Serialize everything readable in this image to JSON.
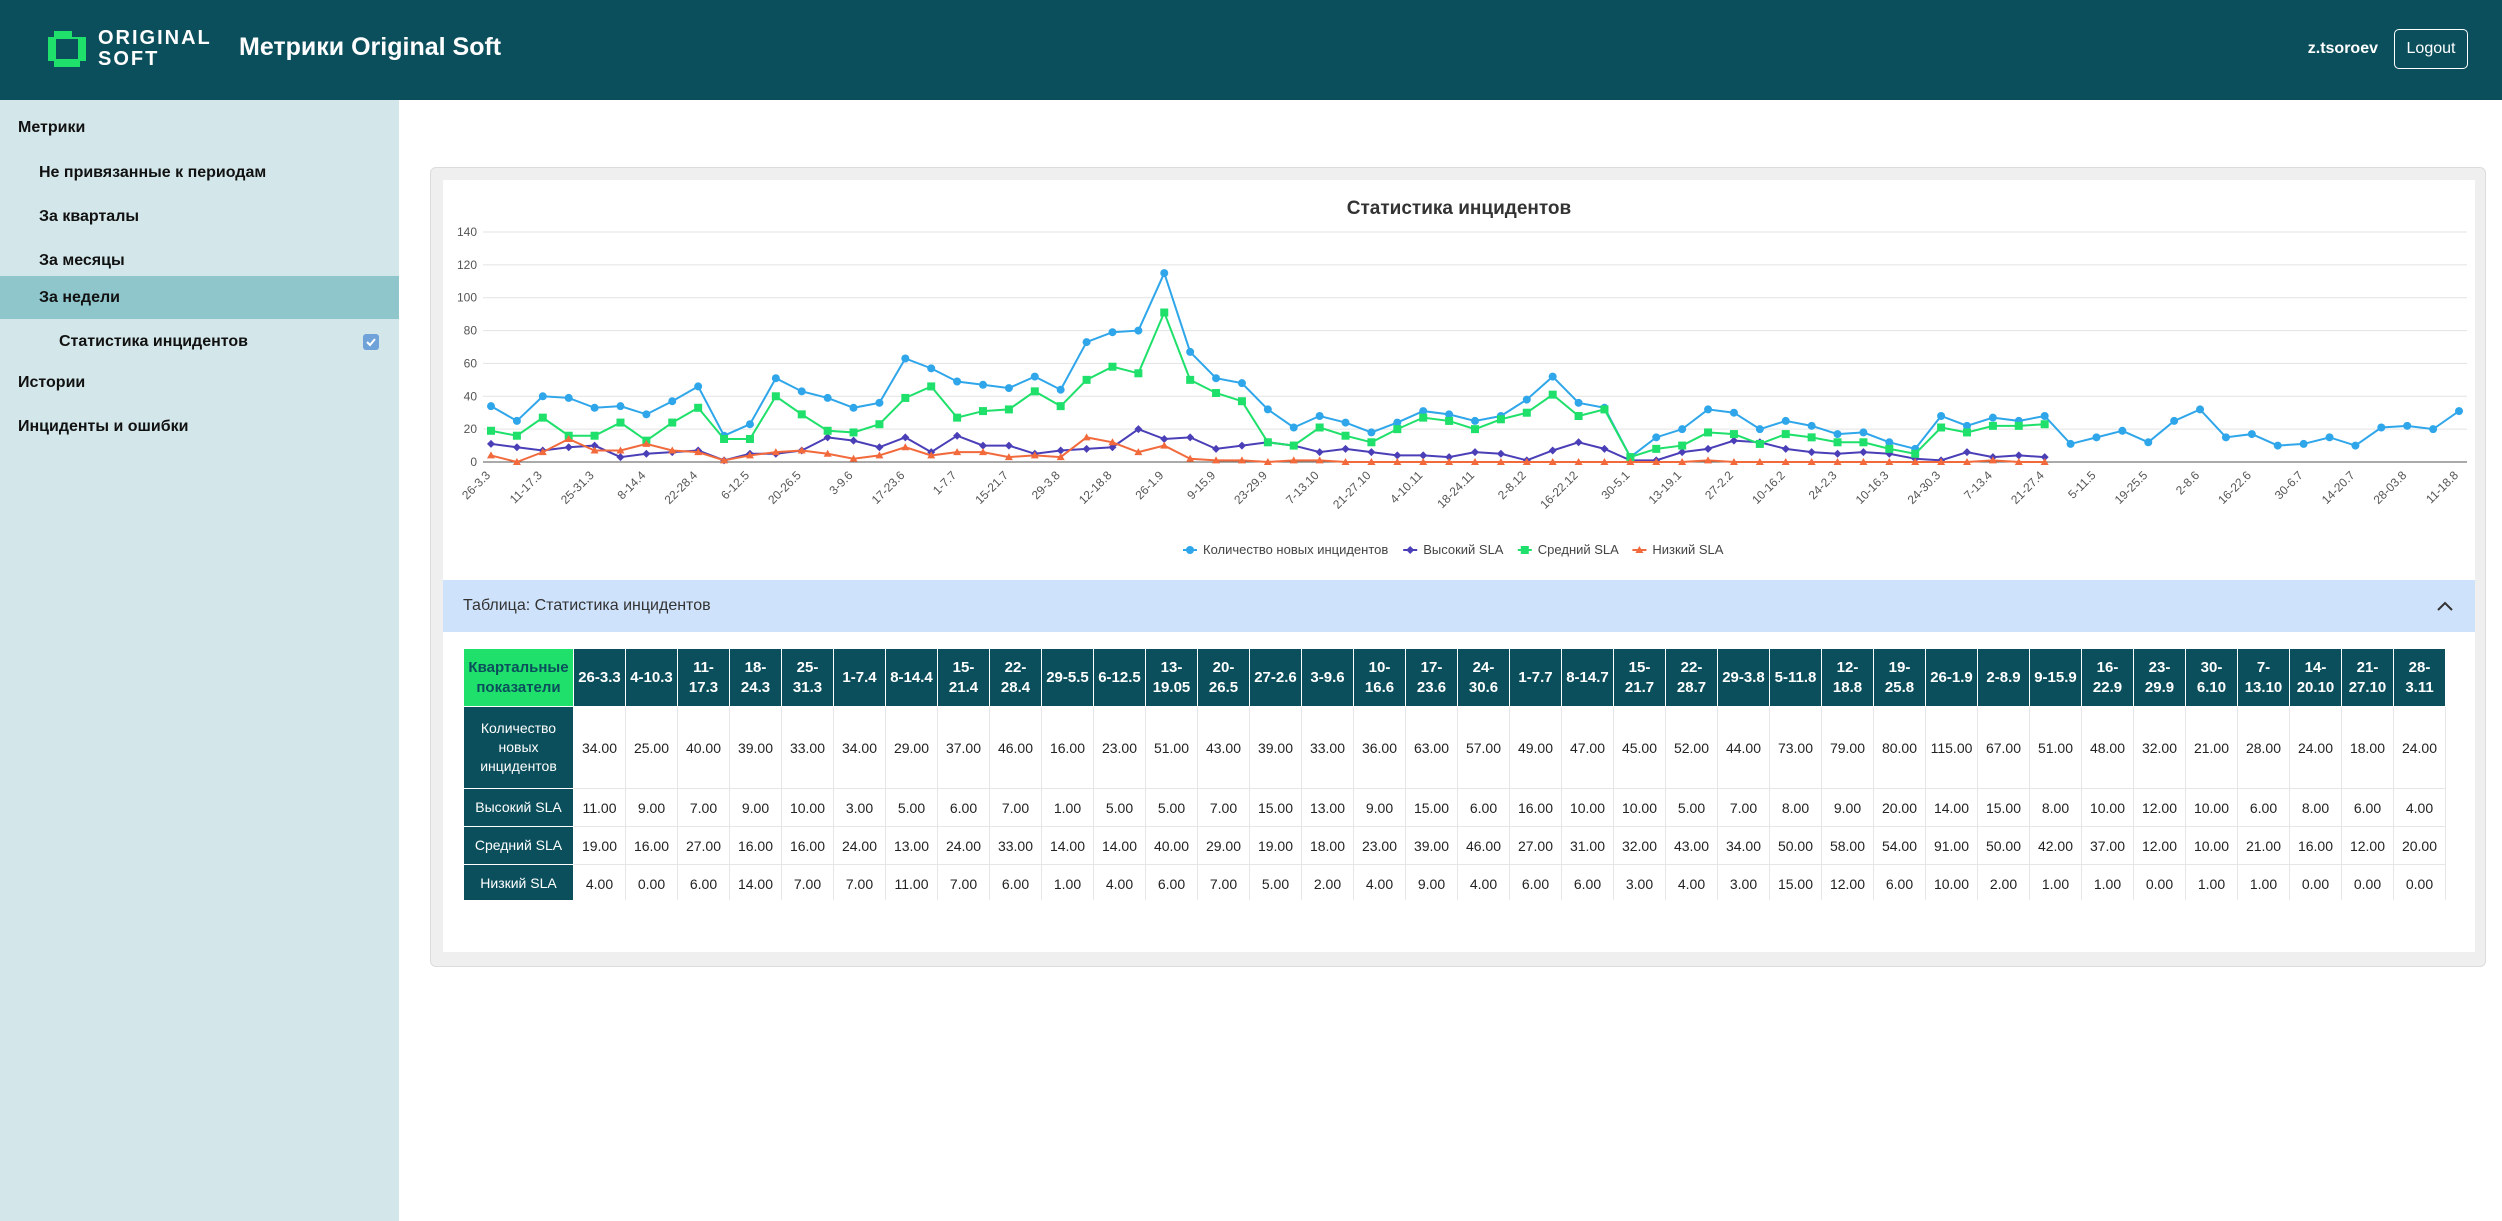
{
  "header": {
    "logo_line1": "ORIGINAL",
    "logo_line2": "SOFT",
    "title": "Метрики Original Soft",
    "username": "z.tsoroev",
    "logout_label": "Logout"
  },
  "sidebar": {
    "items": [
      {
        "label": "Метрики"
      },
      {
        "label": "Не привязанные к периодам"
      },
      {
        "label": "За кварталы"
      },
      {
        "label": "За месяцы"
      },
      {
        "label": "За недели"
      },
      {
        "label": "Статистика инцидентов"
      },
      {
        "label": "Истории"
      },
      {
        "label": "Инциденты и ошибки"
      }
    ]
  },
  "colors": {
    "header_bg": "#0c4f5c",
    "sidebar_bg": "#d3e7ea",
    "sidebar_active": "#8ec6cc",
    "new_incidents": "#2fa6ea",
    "high_sla": "#4b3fb8",
    "medium_sla": "#1ee06a",
    "low_sla": "#f26a3c"
  },
  "table_section": {
    "title": "Таблица: Статистика инцидентов",
    "corner": "Квартальные показатели",
    "columns": [
      "26-3.3",
      "4-10.3",
      "11-17.3",
      "18-24.3",
      "25-31.3",
      "1-7.4",
      "8-14.4",
      "15-21.4",
      "22-28.4",
      "29-5.5",
      "6-12.5",
      "13-19.05",
      "20-26.5",
      "27-2.6",
      "3-9.6",
      "10-16.6",
      "17-23.6",
      "24-30.6",
      "1-7.7",
      "8-14.7",
      "15-21.7",
      "22-28.7",
      "29-3.8",
      "5-11.8",
      "12-18.8",
      "19-25.8",
      "26-1.9",
      "2-8.9",
      "9-15.9",
      "16-22.9",
      "23-29.9",
      "30-6.10",
      "7-13.10",
      "14-20.10",
      "21-27.10",
      "28-3.11"
    ],
    "rows": [
      {
        "label": "Количество новых инцидентов",
        "values": [
          "34.00",
          "25.00",
          "40.00",
          "39.00",
          "33.00",
          "34.00",
          "29.00",
          "37.00",
          "46.00",
          "16.00",
          "23.00",
          "51.00",
          "43.00",
          "39.00",
          "33.00",
          "36.00",
          "63.00",
          "57.00",
          "49.00",
          "47.00",
          "45.00",
          "52.00",
          "44.00",
          "73.00",
          "79.00",
          "80.00",
          "115.00",
          "67.00",
          "51.00",
          "48.00",
          "32.00",
          "21.00",
          "28.00",
          "24.00",
          "18.00",
          "24.00"
        ]
      },
      {
        "label": "Высокий SLA",
        "values": [
          "11.00",
          "9.00",
          "7.00",
          "9.00",
          "10.00",
          "3.00",
          "5.00",
          "6.00",
          "7.00",
          "1.00",
          "5.00",
          "5.00",
          "7.00",
          "15.00",
          "13.00",
          "9.00",
          "15.00",
          "6.00",
          "16.00",
          "10.00",
          "10.00",
          "5.00",
          "7.00",
          "8.00",
          "9.00",
          "20.00",
          "14.00",
          "15.00",
          "8.00",
          "10.00",
          "12.00",
          "10.00",
          "6.00",
          "8.00",
          "6.00",
          "4.00"
        ]
      },
      {
        "label": "Средний SLA",
        "values": [
          "19.00",
          "16.00",
          "27.00",
          "16.00",
          "16.00",
          "24.00",
          "13.00",
          "24.00",
          "33.00",
          "14.00",
          "14.00",
          "40.00",
          "29.00",
          "19.00",
          "18.00",
          "23.00",
          "39.00",
          "46.00",
          "27.00",
          "31.00",
          "32.00",
          "43.00",
          "34.00",
          "50.00",
          "58.00",
          "54.00",
          "91.00",
          "50.00",
          "42.00",
          "37.00",
          "12.00",
          "10.00",
          "21.00",
          "16.00",
          "12.00",
          "20.00"
        ]
      },
      {
        "label": "Низкий SLA",
        "values": [
          "4.00",
          "0.00",
          "6.00",
          "14.00",
          "7.00",
          "7.00",
          "11.00",
          "7.00",
          "6.00",
          "1.00",
          "4.00",
          "6.00",
          "7.00",
          "5.00",
          "2.00",
          "4.00",
          "9.00",
          "4.00",
          "6.00",
          "6.00",
          "3.00",
          "4.00",
          "3.00",
          "15.00",
          "12.00",
          "6.00",
          "10.00",
          "2.00",
          "1.00",
          "1.00",
          "0.00",
          "1.00",
          "1.00",
          "0.00",
          "0.00",
          "0.00"
        ]
      }
    ]
  },
  "chart_data": {
    "type": "line",
    "title": "Статистика инцидентов",
    "ylim": [
      0,
      140
    ],
    "yticks": [
      "0",
      "20",
      "40",
      "60",
      "80",
      "100",
      "120",
      "140"
    ],
    "xticklabels": [
      "26-3.3",
      "11-17.3",
      "25-31.3",
      "8-14.4",
      "22-28.4",
      "6-12.5",
      "20-26.5",
      "3-9.6",
      "17-23.6",
      "1-7.7",
      "15-21.7",
      "29-3.8",
      "12-18.8",
      "26-1.9",
      "9-15.9",
      "23-29.9",
      "7-13.10",
      "21-27.10",
      "4-10.11",
      "18-24.11",
      "2-8.12",
      "16-22.12",
      "30-5.1",
      "13-19.1",
      "27-2.2",
      "10-16.2",
      "24-2.3",
      "10-16.3",
      "24-30.3",
      "7-13.4",
      "21-27.4",
      "5-11.5",
      "19-25.5",
      "2-8.6",
      "16-22.6",
      "30-6.7",
      "14-20.7",
      "28-03.8",
      "11-18.8"
    ],
    "legend_position": "bottom",
    "series": [
      {
        "name": "Количество новых инцидентов",
        "color": "#2fa6ea",
        "marker": "circle",
        "values": [
          34,
          25,
          40,
          39,
          33,
          34,
          29,
          37,
          46,
          16,
          23,
          51,
          43,
          39,
          33,
          36,
          63,
          57,
          49,
          47,
          45,
          52,
          44,
          73,
          79,
          80,
          115,
          67,
          51,
          48,
          32,
          21,
          28,
          24,
          18,
          24,
          31,
          29,
          25,
          28,
          38,
          52,
          36,
          33,
          3,
          15,
          20,
          32,
          30,
          20,
          25,
          22,
          17,
          18,
          12,
          8,
          28,
          22,
          27,
          25,
          28,
          11,
          15,
          19,
          12,
          25,
          32,
          15,
          17,
          10,
          11,
          15,
          10,
          21,
          22,
          20,
          31
        ]
      },
      {
        "name": "Высокий SLA",
        "color": "#4b3fb8",
        "marker": "diamond",
        "values": [
          11,
          9,
          7,
          9,
          10,
          3,
          5,
          6,
          7,
          1,
          5,
          5,
          7,
          15,
          13,
          9,
          15,
          6,
          16,
          10,
          10,
          5,
          7,
          8,
          9,
          20,
          14,
          15,
          8,
          10,
          12,
          10,
          6,
          8,
          6,
          4,
          4,
          3,
          6,
          5,
          1,
          7,
          12,
          8,
          1,
          1,
          6,
          8,
          13,
          12,
          8,
          6,
          5,
          6,
          5,
          2,
          1,
          6,
          3,
          4,
          3
        ]
      },
      {
        "name": "Средний SLA",
        "color": "#1ee06a",
        "marker": "square",
        "values": [
          19,
          16,
          27,
          16,
          16,
          24,
          13,
          24,
          33,
          14,
          14,
          40,
          29,
          19,
          18,
          23,
          39,
          46,
          27,
          31,
          32,
          43,
          34,
          50,
          58,
          54,
          91,
          50,
          42,
          37,
          12,
          10,
          21,
          16,
          12,
          20,
          27,
          25,
          20,
          26,
          30,
          41,
          28,
          32,
          3,
          8,
          10,
          18,
          17,
          11,
          17,
          15,
          12,
          12,
          8,
          5,
          21,
          18,
          22,
          22,
          23
        ]
      },
      {
        "name": "Низкий SLA",
        "color": "#f26a3c",
        "marker": "triangle",
        "values": [
          4,
          0,
          6,
          14,
          7,
          7,
          11,
          7,
          6,
          1,
          4,
          6,
          7,
          5,
          2,
          4,
          9,
          4,
          6,
          6,
          3,
          4,
          3,
          15,
          12,
          6,
          10,
          2,
          1,
          1,
          0,
          1,
          1,
          0,
          0,
          0,
          0,
          0,
          0,
          0,
          0,
          0,
          0,
          0,
          0,
          0,
          0,
          1,
          0,
          0,
          0,
          0,
          0,
          0,
          0,
          0,
          0,
          0,
          1,
          0,
          0
        ]
      }
    ]
  }
}
